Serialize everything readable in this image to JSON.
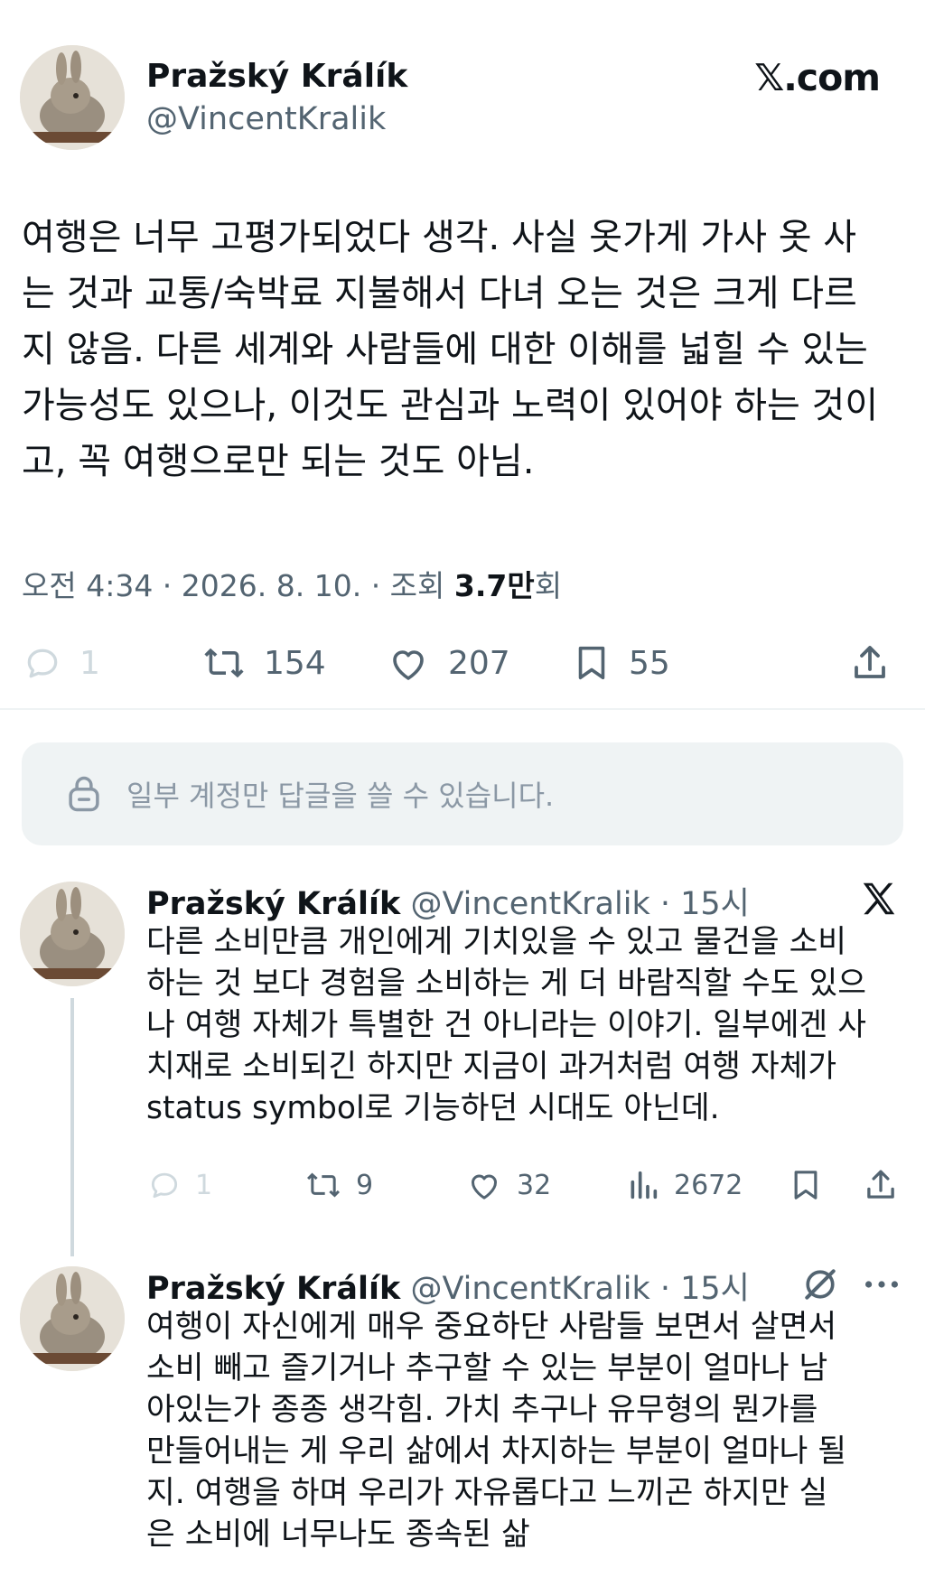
{
  "main_tweet": {
    "author_name": "Pražský Králík",
    "handle": "@VincentKralik",
    "brand": "𝕏.com",
    "text": "여행은 너무 고평가되었다 생각. 사실 옷가게 가사 옷 사\n는 것과 교통/숙박료 지불해서 다녀 오는 것은 크게 다르\n지 않음. 다른 세계와 사람들에 대한 이해를 넓힐 수 있는\n가능성도 있으나, 이것도 관심과 노력이 있어야 하는 것이\n고, 꼭 여행으로만 되는 것도 아님.",
    "meta_prefix": "오전 4:34 · 2026. 8. 10. · 조회 ",
    "views_bold": "3.7만",
    "views_suffix": "회",
    "actions": {
      "replies": "1",
      "retweets": "154",
      "likes": "207",
      "bookmarks": "55"
    }
  },
  "reply_restriction": {
    "label": "일부 계정만 답글을 쓸 수 있습니다."
  },
  "replies": [
    {
      "author_name": "Pražský Králík",
      "handle": "@VincentKralik",
      "time": "· 15시",
      "text": "다른 소비만큼 개인에게 기치있을 수 있고 물건을 소비\n하는 것 보다 경험을 소비하는 게 더 바람직할 수도 있으\n나 여행 자체가 특별한 건 아니라는 이야기. 일부에겐 사\n치재로 소비되긴 하지만 지금이 과거처럼 여행 자체가\nstatus symbol로 기능하던 시대도 아닌데.",
      "actions": {
        "replies": "1",
        "retweets": "9",
        "likes": "32",
        "views": "2672"
      }
    },
    {
      "author_name": "Pražský Králík",
      "handle": "@VincentKralik",
      "time": "· 15시",
      "text": "여행이 자신에게 매우 중요하단 사람들 보면서 살면서\n소비 빼고 즐기거나 추구할 수 있는 부분이 얼마나 남\n아있는가 종종 생각힘. 가치 추구나 유무형의 뭔가를\n만들어내는 게 우리 삶에서 차지하는 부분이 얼마나 될\n지. 여행을 하며 우리가 자유롭다고 느끼곤 하지만 실\n은 소비에 너무나도 종속된 삶"
    }
  ],
  "colors": {
    "text": "#0f1419",
    "secondary": "#536471",
    "faint": "#cfd9de",
    "box": "#eff3f4"
  },
  "icons": [
    "reply-icon",
    "retweet-icon",
    "like-icon",
    "bookmark-icon",
    "share-icon",
    "lock-icon",
    "x-logo-icon",
    "grok-icon",
    "more-icon",
    "views-icon"
  ]
}
